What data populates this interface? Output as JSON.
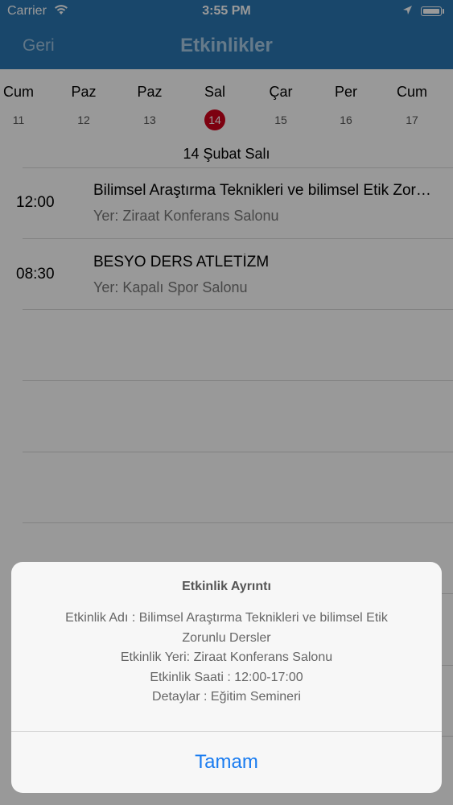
{
  "status_bar": {
    "carrier": "Carrier",
    "time": "3:55 PM"
  },
  "nav": {
    "back_label": "Geri",
    "title": "Etkinlikler"
  },
  "week": [
    {
      "name": "Cum",
      "date": "11",
      "selected": false
    },
    {
      "name": "Paz",
      "date": "12",
      "selected": false
    },
    {
      "name": "Paz",
      "date": "13",
      "selected": false
    },
    {
      "name": "Sal",
      "date": "14",
      "selected": true
    },
    {
      "name": "Çar",
      "date": "15",
      "selected": false
    },
    {
      "name": "Per",
      "date": "16",
      "selected": false
    },
    {
      "name": "Cum",
      "date": "17",
      "selected": false
    }
  ],
  "date_heading": "14 Şubat Salı",
  "events": [
    {
      "time": "12:00",
      "name": "Bilimsel Araştırma Teknikleri ve bilimsel Etik Zorunlu Dersler",
      "place": "Yer: Ziraat Konferans Salonu"
    },
    {
      "time": "08:30",
      "name": "BESYO DERS ATLETİZM",
      "place": "Yer: Kapalı Spor Salonu"
    }
  ],
  "alert": {
    "title": "Etkinlik Ayrıntı",
    "lines": [
      "Etkinlik Adı : Bilimsel Araştırma Teknikleri ve bilimsel Etik",
      "Zorunlu Dersler",
      "Etkinlik Yeri: Ziraat Konferans Salonu",
      "Etkinlik Saati : 12:00-17:00",
      "Detaylar : Eğitim Semineri"
    ],
    "button_label": "Tamam"
  },
  "colors": {
    "nav_bg": "#2a77b2",
    "selected_day": "#d0021b",
    "alert_button": "#1a7cf0"
  }
}
